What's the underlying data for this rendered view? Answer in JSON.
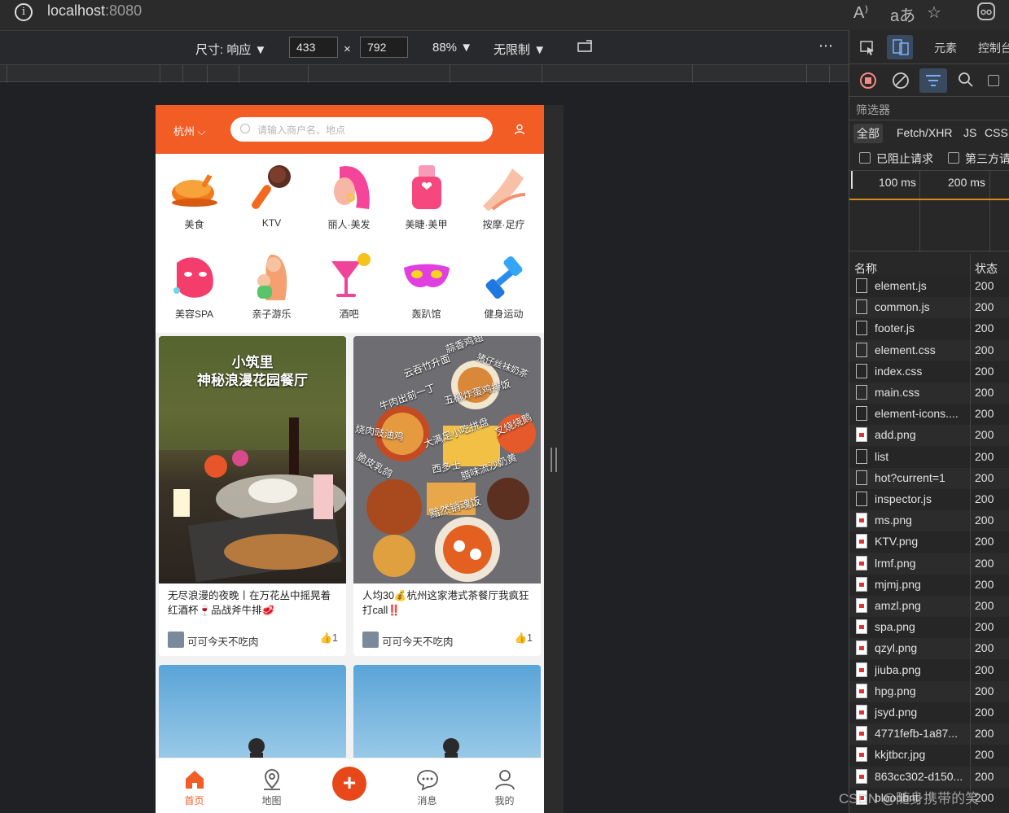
{
  "browser": {
    "url_host": "localhost",
    "url_port": ":8080"
  },
  "device_toolbar": {
    "size_label": "尺寸: 响应",
    "width": "433",
    "times": "×",
    "height": "792",
    "zoom": "88%",
    "throttle": "无限制",
    "more": "⋯"
  },
  "app": {
    "city": "杭州",
    "search_placeholder": "请输入商户名、地点",
    "categories": [
      {
        "label": "美食",
        "icon": "roast-chicken-icon"
      },
      {
        "label": "KTV",
        "icon": "microphone-icon"
      },
      {
        "label": "丽人·美发",
        "icon": "hair-woman-icon"
      },
      {
        "label": "美睫·美甲",
        "icon": "nail-polish-icon"
      },
      {
        "label": "按摩·足疗",
        "icon": "massage-hand-icon"
      },
      {
        "label": "美容SPA",
        "icon": "face-mask-icon"
      },
      {
        "label": "亲子游乐",
        "icon": "mother-child-icon"
      },
      {
        "label": "酒吧",
        "icon": "cocktail-icon"
      },
      {
        "label": "轰趴馆",
        "icon": "party-mask-icon"
      },
      {
        "label": "健身运动",
        "icon": "dumbbell-icon"
      }
    ],
    "cards": [
      {
        "image_text_1": "小筑里",
        "image_text_2": "神秘浪漫花园餐厅",
        "title": "无尽浪漫的夜晚丨在万花丛中摇晃着红酒杯🍷品战斧牛排🥩",
        "author": "可可今天不吃肉",
        "likes": "1"
      },
      {
        "image_labels": [
          "蒜香鸡翅",
          "云吞竹升面",
          "猪仔丝袜奶茶",
          "牛肉出前一丁",
          "五柳炸蛋鸡排饭",
          "烧肉豉油鸡",
          "大满足小吃拼盘",
          "叉烧烧鹅",
          "脆皮乳鸽",
          "西多士",
          "腊味流沙奶黄",
          "黯然销魂饭"
        ],
        "title": "人均30💰杭州这家港式茶餐厅我疯狂打call‼️",
        "author": "可可今天不吃肉",
        "likes": "1"
      }
    ],
    "tabs": [
      {
        "label": "首页",
        "icon": "home-icon"
      },
      {
        "label": "地图",
        "icon": "map-pin-icon"
      },
      {
        "label": "",
        "icon": "plus-icon"
      },
      {
        "label": "消息",
        "icon": "chat-bubble-icon"
      },
      {
        "label": "我的",
        "icon": "user-icon"
      }
    ],
    "plus_symbol": "+"
  },
  "devtools": {
    "tab_elements": "元素",
    "tab_console": "控制台",
    "filter_label": "筛选器",
    "type_all": "全部",
    "type_fetch": "Fetch/XHR",
    "type_js": "JS",
    "type_css": "CSS",
    "blocked_requests": "已阻止请求",
    "third_party": "第三方请求",
    "timeline_100": "100 ms",
    "timeline_200": "200 ms",
    "col_name": "名称",
    "col_status": "状态",
    "requests": [
      {
        "name": "element.js",
        "status": "200",
        "type": "doc"
      },
      {
        "name": "common.js",
        "status": "200",
        "type": "doc"
      },
      {
        "name": "footer.js",
        "status": "200",
        "type": "doc"
      },
      {
        "name": "element.css",
        "status": "200",
        "type": "doc"
      },
      {
        "name": "index.css",
        "status": "200",
        "type": "doc"
      },
      {
        "name": "main.css",
        "status": "200",
        "type": "doc"
      },
      {
        "name": "element-icons....",
        "status": "200",
        "type": "doc"
      },
      {
        "name": "add.png",
        "status": "200",
        "type": "img"
      },
      {
        "name": "list",
        "status": "200",
        "type": "doc"
      },
      {
        "name": "hot?current=1",
        "status": "200",
        "type": "doc"
      },
      {
        "name": "inspector.js",
        "status": "200",
        "type": "doc"
      },
      {
        "name": "ms.png",
        "status": "200",
        "type": "img"
      },
      {
        "name": "KTV.png",
        "status": "200",
        "type": "img"
      },
      {
        "name": "lrmf.png",
        "status": "200",
        "type": "img"
      },
      {
        "name": "mjmj.png",
        "status": "200",
        "type": "img"
      },
      {
        "name": "amzl.png",
        "status": "200",
        "type": "img"
      },
      {
        "name": "spa.png",
        "status": "200",
        "type": "img"
      },
      {
        "name": "qzyl.png",
        "status": "200",
        "type": "img"
      },
      {
        "name": "jiuba.png",
        "status": "200",
        "type": "img"
      },
      {
        "name": "hpg.png",
        "status": "200",
        "type": "img"
      },
      {
        "name": "jsyd.png",
        "status": "200",
        "type": "img"
      },
      {
        "name": "4771fefb-1a87...",
        "status": "200",
        "type": "img"
      },
      {
        "name": "kkjtbcr.jpg",
        "status": "200",
        "type": "img"
      },
      {
        "name": "863cc302-d150...",
        "status": "200",
        "type": "img"
      },
      {
        "name": "bloodbnt",
        "status": "200",
        "type": "img"
      }
    ]
  },
  "watermark": "CSDN @随身携带的笑"
}
